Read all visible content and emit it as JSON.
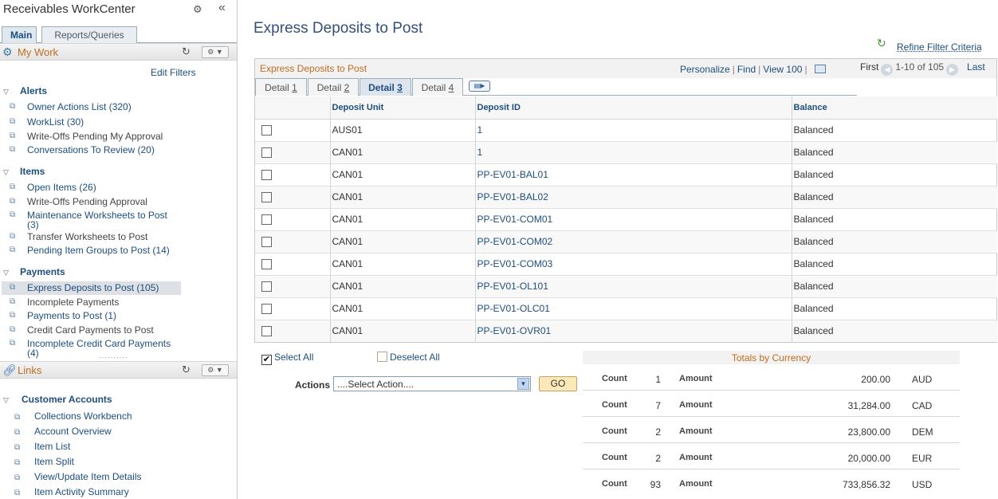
{
  "left_panel": {
    "title": "Receivables WorkCenter",
    "tabs": [
      "Main",
      "Reports/Queries"
    ],
    "my_work": {
      "label": "My Work",
      "edit_filters": "Edit Filters",
      "sections": [
        {
          "title": "Alerts",
          "items": [
            {
              "label": "Owner Actions List (320)",
              "link": true
            },
            {
              "label": "WorkList (30)",
              "link": true
            },
            {
              "label": "Write-Offs Pending My Approval",
              "link": false
            },
            {
              "label": "Conversations To Review (20)",
              "link": true
            }
          ]
        },
        {
          "title": "Items",
          "items": [
            {
              "label": "Open Items (26)",
              "link": true
            },
            {
              "label": "Write-Offs Pending Approval",
              "link": false
            },
            {
              "label": "Maintenance Worksheets to Post (3)",
              "link": true
            },
            {
              "label": "Transfer Worksheets to Post",
              "link": false
            },
            {
              "label": "Pending Item Groups to Post (14)",
              "link": true
            }
          ]
        },
        {
          "title": "Payments",
          "items": [
            {
              "label": "Express Deposits to Post (105)",
              "link": true,
              "selected": true
            },
            {
              "label": "Incomplete Payments",
              "link": false
            },
            {
              "label": "Payments to Post (1)",
              "link": true
            },
            {
              "label": "Credit Card Payments to Post",
              "link": false
            },
            {
              "label": "Incomplete Credit Card Payments (4)",
              "link": true
            }
          ]
        }
      ]
    },
    "links": {
      "label": "Links",
      "section": "Customer Accounts",
      "items": [
        "Collections Workbench",
        "Account Overview",
        "Item List",
        "Item Split",
        "View/Update Item Details",
        "Item Activity Summary"
      ]
    }
  },
  "main": {
    "page_title": "Express Deposits to Post",
    "refine_filter": "Refine Filter Criteria",
    "grid": {
      "title": "Express Deposits to Post",
      "nav": {
        "personalize": "Personalize",
        "find": "Find",
        "view": "View 100"
      },
      "pager": {
        "first": "First",
        "range": "1-10 of 105",
        "last": "Last"
      },
      "tabs": [
        {
          "prefix": "Detail ",
          "num": "1"
        },
        {
          "prefix": "Detail ",
          "num": "2"
        },
        {
          "prefix": "Detail ",
          "num": "3",
          "active": true
        },
        {
          "prefix": "Detail ",
          "num": "4"
        }
      ],
      "columns": [
        "",
        "Deposit Unit",
        "Deposit ID",
        "Balance"
      ],
      "rows": [
        {
          "unit": "AUS01",
          "id": "1",
          "balance": "Balanced"
        },
        {
          "unit": "CAN01",
          "id": "1",
          "balance": "Balanced"
        },
        {
          "unit": "CAN01",
          "id": "PP-EV01-BAL01",
          "balance": "Balanced"
        },
        {
          "unit": "CAN01",
          "id": "PP-EV01-BAL02",
          "balance": "Balanced"
        },
        {
          "unit": "CAN01",
          "id": "PP-EV01-COM01",
          "balance": "Balanced"
        },
        {
          "unit": "CAN01",
          "id": "PP-EV01-COM02",
          "balance": "Balanced"
        },
        {
          "unit": "CAN01",
          "id": "PP-EV01-COM03",
          "balance": "Balanced"
        },
        {
          "unit": "CAN01",
          "id": "PP-EV01-OL101",
          "balance": "Balanced"
        },
        {
          "unit": "CAN01",
          "id": "PP-EV01-OLC01",
          "balance": "Balanced"
        },
        {
          "unit": "CAN01",
          "id": "PP-EV01-OVR01",
          "balance": "Balanced"
        }
      ]
    },
    "select_all": "Select All",
    "deselect_all": "Deselect All",
    "actions": {
      "label": "Actions",
      "selected": "....Select Action....",
      "go": "GO"
    },
    "totals": {
      "title": "Totals by Currency",
      "count_label": "Count",
      "amount_label": "Amount",
      "rows": [
        {
          "count": "1",
          "amount": "200.00",
          "currency": "AUD"
        },
        {
          "count": "7",
          "amount": "31,284.00",
          "currency": "CAD"
        },
        {
          "count": "2",
          "amount": "23,800.00",
          "currency": "DEM"
        },
        {
          "count": "2",
          "amount": "20,000.00",
          "currency": "EUR"
        },
        {
          "count": "93",
          "amount": "733,856.32",
          "currency": "USD"
        }
      ]
    }
  },
  "colors": {
    "accent": "#1d4e7e",
    "header_orange": "#c16c1e",
    "title_blue": "#34507a"
  }
}
